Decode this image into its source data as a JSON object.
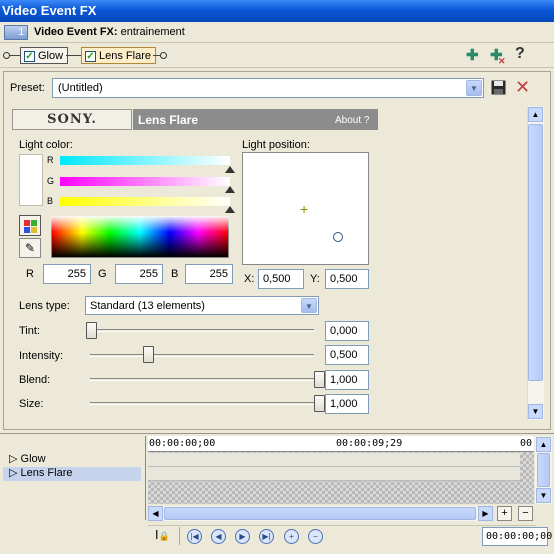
{
  "window": {
    "title": "Video Event FX"
  },
  "header": {
    "track_number": "1",
    "title_bold": "Video Event FX:",
    "title_rest": " entrainement"
  },
  "chain": {
    "plugins": [
      {
        "label": "Glow",
        "checked": true
      },
      {
        "label": "Lens Flare",
        "checked": true
      }
    ],
    "tools": {
      "add_icon": "plug-add-icon",
      "remove_icon": "plug-remove-icon",
      "help": "?"
    }
  },
  "preset": {
    "label": "Preset:",
    "value": "(Untitled)"
  },
  "plugin": {
    "brand": "SONY.",
    "name": "Lens Flare",
    "about": "About  ?",
    "light_color": {
      "label": "Light color:",
      "channels": [
        "R",
        "G",
        "B"
      ],
      "r": "255",
      "g": "255",
      "b": "255",
      "r_label": "R",
      "g_label": "G",
      "b_label": "B"
    },
    "light_position": {
      "label": "Light position:",
      "x_label": "X:",
      "x": "0,500",
      "y_label": "Y:",
      "y": "0,500"
    },
    "lens_type": {
      "label": "Lens type:",
      "value": "Standard (13 elements)"
    },
    "params": [
      {
        "label": "Tint:",
        "value": "0,000",
        "level": 0.0
      },
      {
        "label": "Intensity:",
        "value": "0,500",
        "level": 0.25
      },
      {
        "label": "Blend:",
        "value": "1,000",
        "level": 1.0
      },
      {
        "label": "Size:",
        "value": "1,000",
        "level": 1.0
      }
    ]
  },
  "timeline": {
    "tracks": [
      "Glow",
      "Lens Flare"
    ],
    "ruler": {
      "start": "00:00:00;00",
      "mid": "00:00:09;29",
      "end": "00"
    },
    "time": "00:00:00;00"
  },
  "colors": {
    "titlebar": "#0a58d8",
    "accent": "#316ac5"
  }
}
